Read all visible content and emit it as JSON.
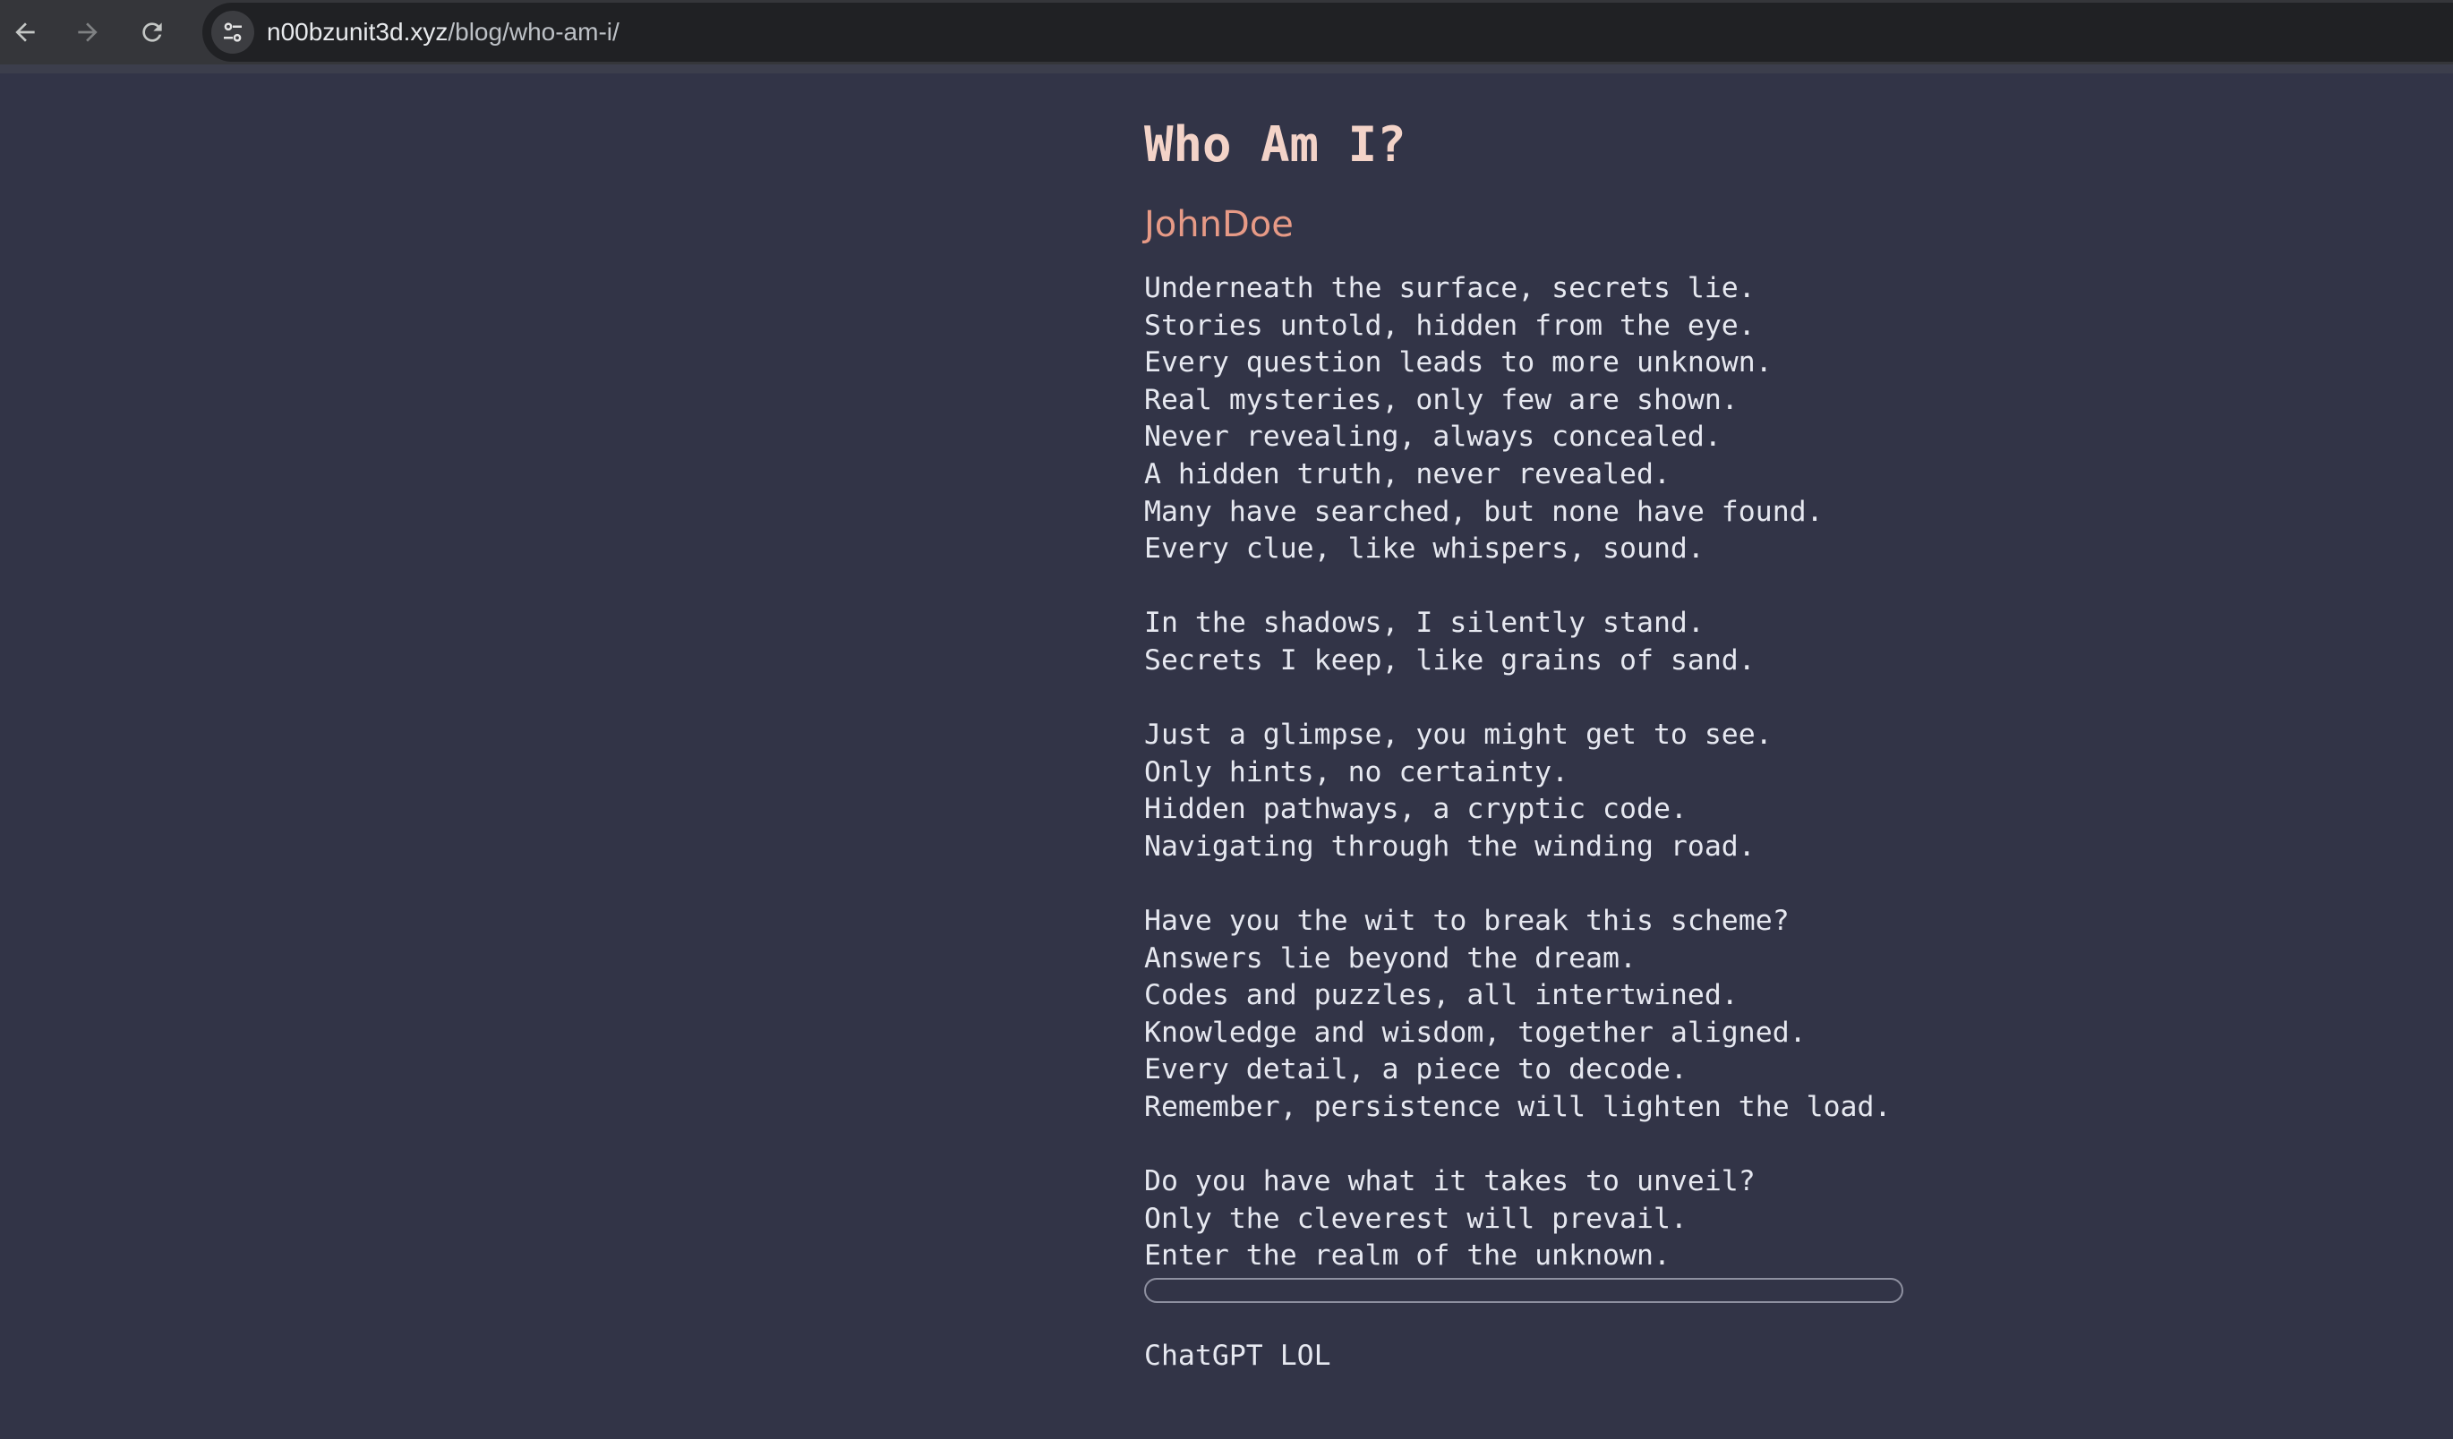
{
  "browser": {
    "url_host": "n00bzunit3d.xyz",
    "url_path": "/blog/who-am-i/",
    "back_icon": "arrow-left-icon",
    "forward_icon": "arrow-right-icon",
    "reload_icon": "reload-icon",
    "site_info_icon": "tune-icon"
  },
  "post": {
    "title": "Who Am I?",
    "author": "JohnDoe",
    "lines": [
      "Underneath the surface, secrets lie.",
      "Stories untold, hidden from the eye.",
      "Every question leads to more unknown.",
      "Real mysteries, only few are shown.",
      "Never revealing, always concealed.",
      "A hidden truth, never revealed.",
      "Many have searched, but none have found.",
      "Every clue, like whispers, sound.",
      "",
      "In the shadows, I silently stand.",
      "Secrets I keep, like grains of sand.",
      "",
      "Just a glimpse, you might get to see.",
      "Only hints, no certainty.",
      "Hidden pathways, a cryptic code.",
      "Navigating through the winding road.",
      "",
      "Have you the wit to break this scheme?",
      "Answers lie beyond the dream.",
      "Codes and puzzles, all intertwined.",
      "Knowledge and wisdom, together aligned.",
      "Every detail, a piece to decode.",
      "Remember, persistence will lighten the load.",
      "",
      "Do you have what it takes to unveil?",
      "Only the cleverest will prevail.",
      "Enter the realm of the unknown."
    ],
    "footer": "ChatGPT LOL"
  },
  "colors": {
    "page_bg": "#323447",
    "title": "#f3d3c8",
    "author": "#e79a86",
    "text": "#e6e8f0"
  }
}
